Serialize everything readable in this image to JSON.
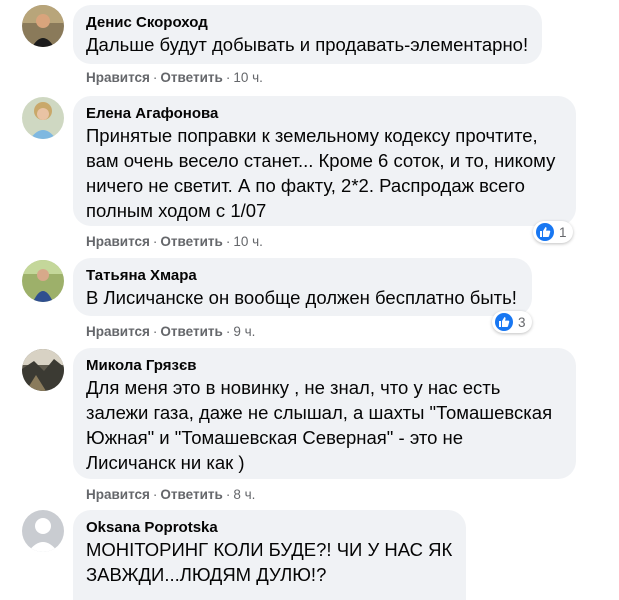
{
  "actions": {
    "like": "Нравится",
    "reply": "Ответить",
    "sep": "·"
  },
  "comments": [
    {
      "author": "Денис Скороход",
      "text": "Дальше будут добывать и продавать-элементарно!",
      "time": "10 ч.",
      "avatar_icon": "user-photo-avatar"
    },
    {
      "author": "Елена Агафонова",
      "text": "Принятые поправки к земельному кодексу прочтите,\nвам очень весело станет... Кроме 6 соток, и то, никому\nничего не светит. А по факту, 2*2. Распродаж всего\nполным ходом с 1/07",
      "time": "10 ч.",
      "reactions": {
        "icon": "like-icon",
        "count": "1"
      },
      "avatar_icon": "user-photo-avatar"
    },
    {
      "author": "Татьяна Хмара",
      "text": "В Лисичанске он вообще должен бесплатно быть!",
      "time": "9 ч.",
      "reactions": {
        "icon": "like-icon",
        "count": "3"
      },
      "avatar_icon": "user-photo-avatar"
    },
    {
      "author": "Микола Грязєв",
      "text": "Для меня это в новинку , не знал, что у нас есть\nзалежи газа, даже не слышал, а шахты \"Томашевская\nЮжная\" и \"Томашевская Северная\" - это не\nЛисичанск ни как )",
      "time": "8 ч.",
      "avatar_icon": "user-photo-avatar"
    },
    {
      "author": "Oksana Poprotska",
      "text": "МОНІТОРИНГ КОЛИ БУДЕ?! ЧИ У НАС ЯК\nЗАВЖДИ...ЛЮДЯМ ДУЛЮ!?",
      "avatar_icon": "default-avatar"
    }
  ],
  "colors": {
    "bubble": "#f0f2f5",
    "meta": "#65676b",
    "text": "#050505",
    "like": "#1877f2"
  }
}
